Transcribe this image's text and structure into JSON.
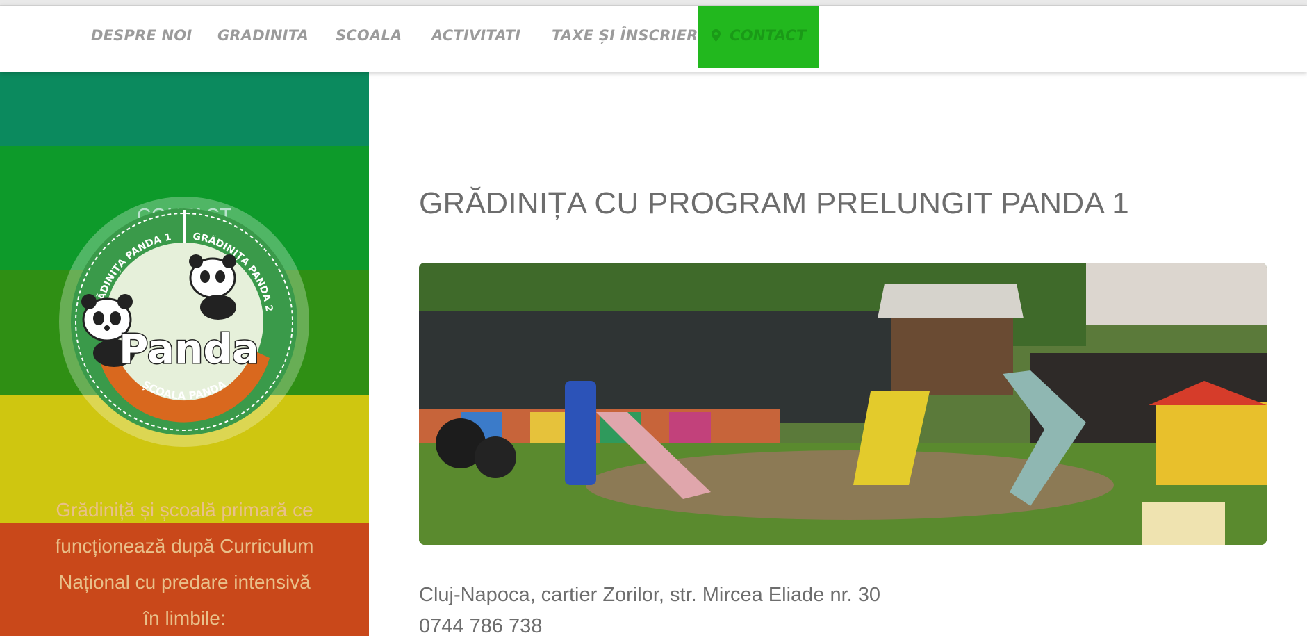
{
  "nav": {
    "items": [
      {
        "label": "DESPRE NOI"
      },
      {
        "label": "GRADINITA"
      },
      {
        "label": "SCOALA"
      },
      {
        "label": "ACTIVITATI"
      },
      {
        "label": "TAXE ȘI ÎNSCRIERI"
      },
      {
        "label": "CONTACT",
        "icon": "map-pin-icon",
        "active": true
      }
    ],
    "active_color": "#22b81e"
  },
  "sidebar": {
    "title": "CONTACT",
    "logo": {
      "top_left_arc": "GRĂDINIȚA PANDA 1",
      "top_right_arc": "GRĂDINIȚA PANDA 2",
      "brand": "Panda",
      "bottom_arc": "ȘCOALA PANDA"
    },
    "description_lines": [
      "Grădiniță și școală primară ce",
      "funcționează după Curriculum",
      "Național cu predare intensivă",
      "în limbile:"
    ],
    "band_colors": [
      "#0b8a5e",
      "#0d9a2a",
      "#2f8f14",
      "#cfc610",
      "#c9481a"
    ]
  },
  "main": {
    "title": "GRĂDINIȚA CU PROGRAM PRELUNGIT PANDA 1",
    "address": "Cluj-Napoca, cartier Zorilor, str. Mircea Eliade nr. 30",
    "phone": "0744 786 738"
  }
}
